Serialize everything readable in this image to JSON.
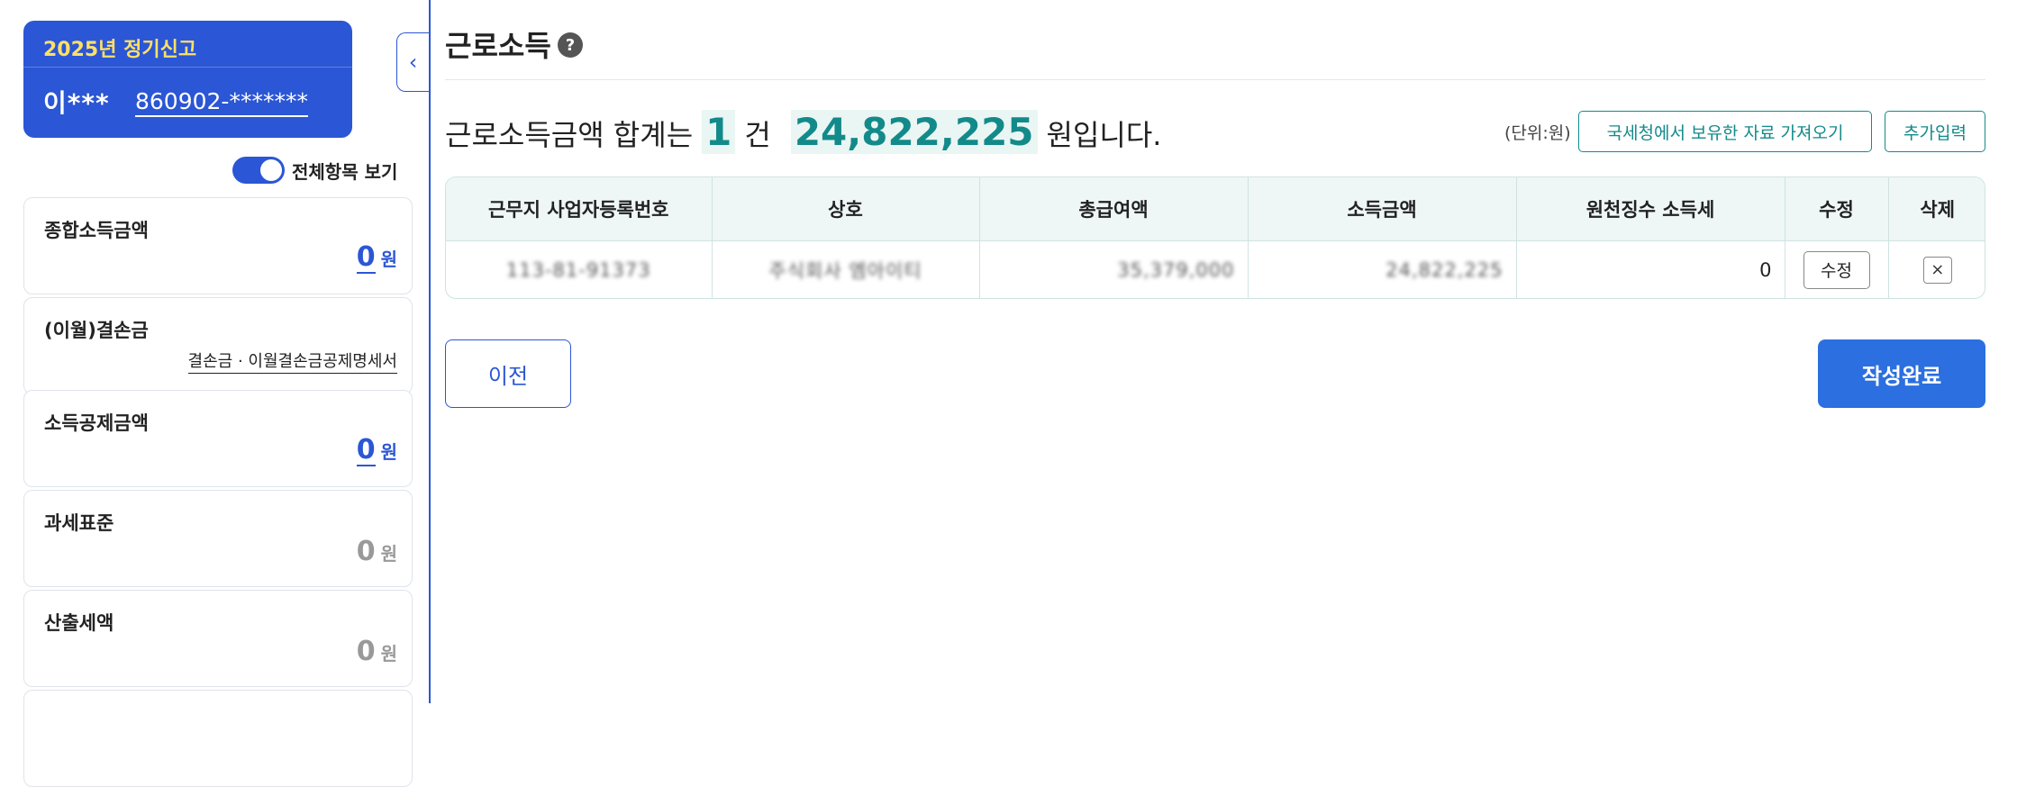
{
  "sidebar": {
    "report_title": "2025년 정기신고",
    "user_name": "이***",
    "user_rrn": "860902-*******",
    "toggle_label": "전체항목 보기",
    "cards": [
      {
        "label": "종합소득금액",
        "value": "0",
        "unit": "원"
      },
      {
        "label": "(이월)결손금",
        "link": "결손금 · 이월결손금공제명세서"
      },
      {
        "label": "소득공제금액",
        "value": "0",
        "unit": "원"
      },
      {
        "label": "과세표준",
        "value": "0",
        "unit": "원"
      },
      {
        "label": "산출세액",
        "value": "0",
        "unit": "원"
      }
    ]
  },
  "main": {
    "title": "근로소득",
    "help_icon": "?",
    "summary": {
      "prefix": "근로소득금액 합계는",
      "count": "1",
      "count_unit": "건",
      "amount": "24,822,225",
      "suffix": "원입니다."
    },
    "unit_note": "(단위:원)",
    "fetch_button": "국세청에서 보유한 자료 가져오기",
    "add_button": "추가입력",
    "table": {
      "headers": [
        "근무지 사업자등록번호",
        "상호",
        "총급여액",
        "소득금액",
        "원천징수 소득세",
        "수정",
        "삭제"
      ],
      "rows": [
        {
          "brn": "113-81-91373",
          "company": "주식회사 엠아이티",
          "total_salary": "35,379,000",
          "income": "24,822,225",
          "withholding": "0",
          "edit": "수정",
          "delete": "×"
        }
      ]
    },
    "prev_button": "이전",
    "done_button": "작성완료"
  }
}
